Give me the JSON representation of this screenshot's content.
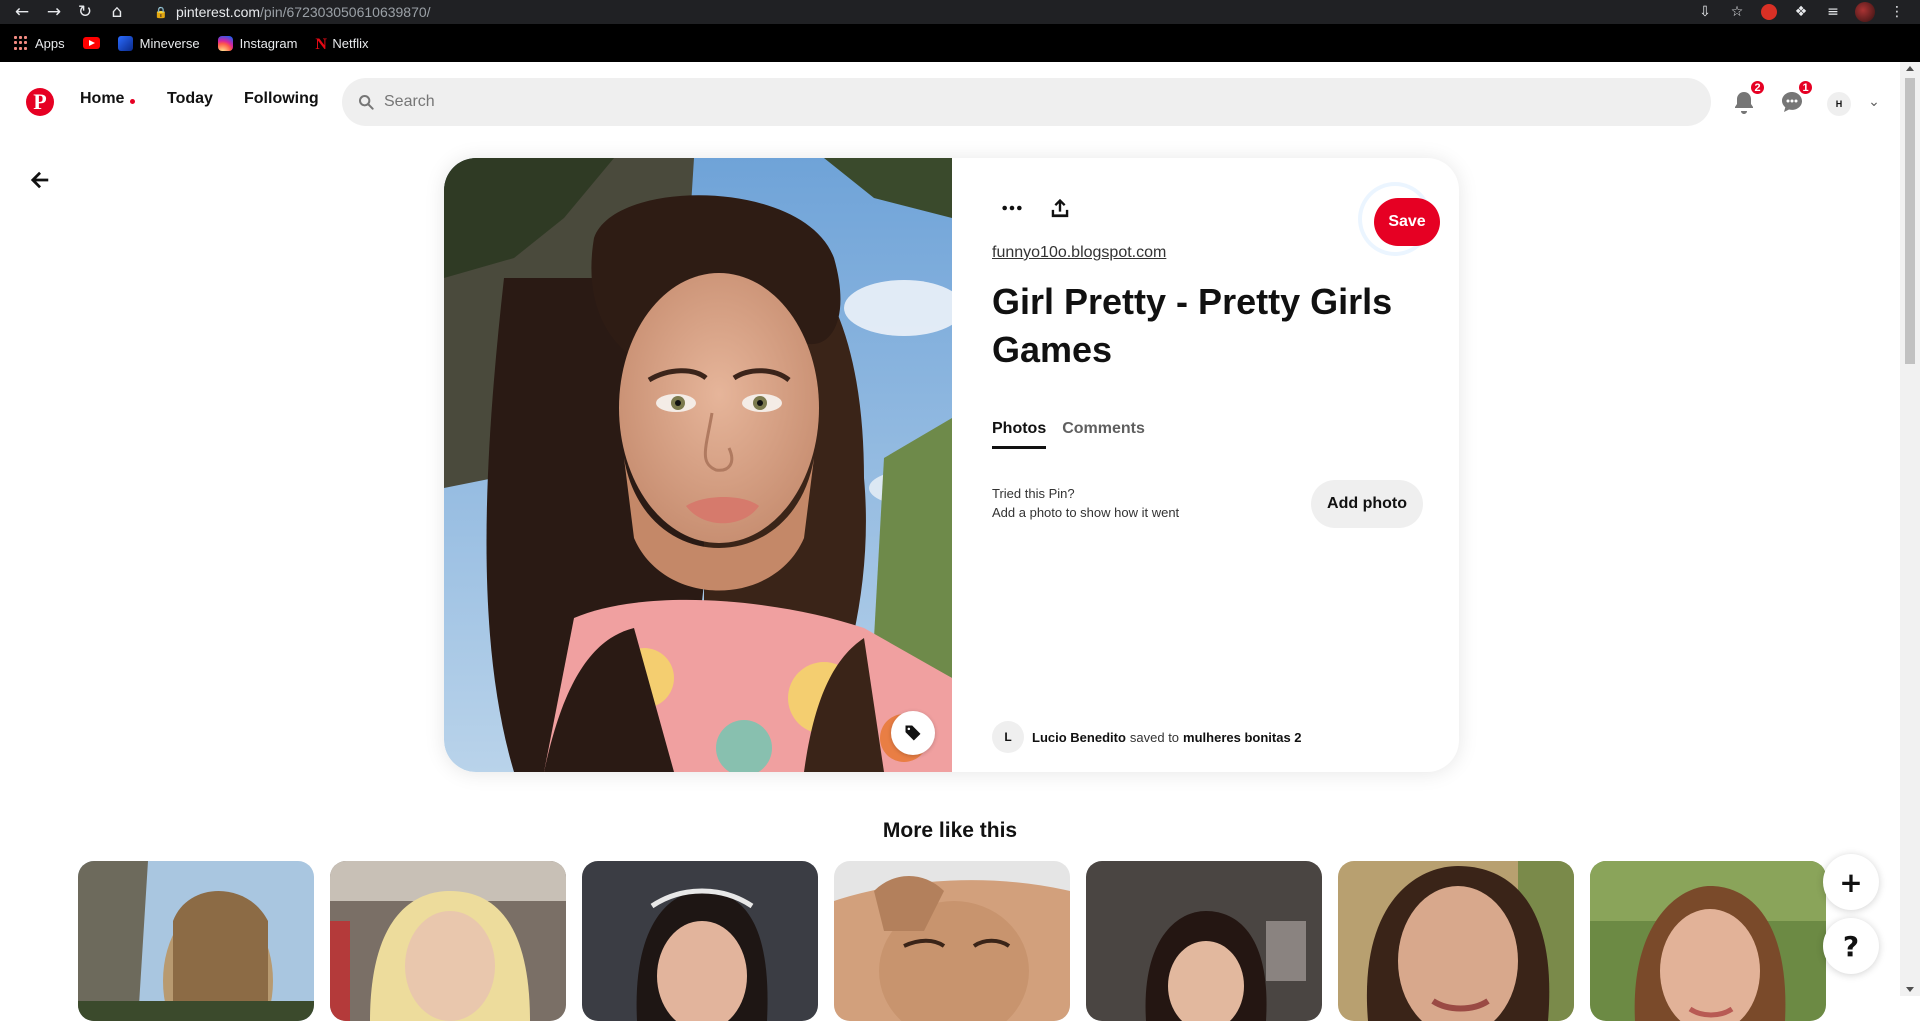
{
  "browser": {
    "url_host": "pinterest.com",
    "url_path": "/pin/672303050610639870/",
    "bookmarks": [
      {
        "label": "Apps",
        "icon": "apps-grid-icon"
      },
      {
        "label": "",
        "icon": "youtube-icon"
      },
      {
        "label": "Mineverse",
        "icon": "mineverse-icon"
      },
      {
        "label": "Instagram",
        "icon": "instagram-icon"
      },
      {
        "label": "Netflix",
        "icon": "netflix-icon"
      }
    ],
    "netflix_glyph": "N"
  },
  "header": {
    "logo_glyph": "P",
    "nav": {
      "home": "Home",
      "today": "Today",
      "following": "Following"
    },
    "search_placeholder": "Search",
    "notifications_count": "2",
    "messages_count": "1",
    "avatar_initial": "H",
    "brand_color": "#e60023"
  },
  "pin": {
    "save_label": "Save",
    "source": "funnyo10o.blogspot.com",
    "title": "Girl Pretty - Pretty Girls Games",
    "tabs": [
      {
        "label": "Photos",
        "active": true
      },
      {
        "label": "Comments",
        "active": false
      }
    ],
    "tried_title": "Tried this Pin?",
    "tried_subtitle": "Add a photo to show how it went",
    "add_photo_label": "Add photo",
    "saver_initial": "L",
    "saver_name": "Lucio Benedito",
    "saved_to_text": "saved to",
    "board_name": "mulheres bonitas 2"
  },
  "more_like_this": {
    "heading": "More like this",
    "items": [
      {
        "name": "related-pin-1"
      },
      {
        "name": "related-pin-2"
      },
      {
        "name": "related-pin-3"
      },
      {
        "name": "related-pin-4"
      },
      {
        "name": "related-pin-5"
      },
      {
        "name": "related-pin-6"
      },
      {
        "name": "related-pin-7"
      }
    ]
  },
  "fabs": {
    "plus": "+",
    "help": "?"
  }
}
